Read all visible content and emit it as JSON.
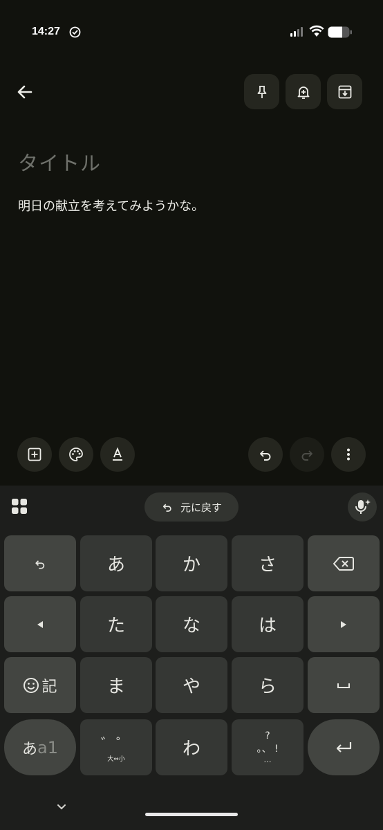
{
  "status_bar": {
    "time": "14:27",
    "icons": [
      "check-circle-icon",
      "signal-icon",
      "wifi-icon",
      "battery-icon"
    ]
  },
  "toolbar": {
    "back_icon": "arrow-left-icon",
    "actions": [
      "pin-icon",
      "reminder-bell-icon",
      "archive-icon"
    ]
  },
  "note": {
    "title_placeholder": "タイトル",
    "body": "明日の献立を考えてみようかな。"
  },
  "editor_toolbar": {
    "left": [
      "add-box-icon",
      "palette-icon",
      "text-format-icon"
    ],
    "right": [
      "undo-icon",
      "redo-icon",
      "more-vert-icon"
    ]
  },
  "keyboard": {
    "undo_suggestion": "元に戻す",
    "keys": {
      "a": "あ",
      "ka": "か",
      "sa": "さ",
      "ta": "た",
      "na": "な",
      "ha": "は",
      "ma": "ま",
      "ya": "や",
      "ra": "ら",
      "wa": "わ",
      "emoji_kigou": "記",
      "mode_a": "あ",
      "mode_alpha": "a1",
      "dakuten": "゛゜",
      "size_toggle": "大⇔小",
      "punct_q": "?",
      "punct_dots": "。、 !",
      "punct_ellipsis": "…"
    },
    "colors": {
      "background": "#1d1e1c",
      "key": "#353734",
      "function_key": "#434541"
    }
  }
}
